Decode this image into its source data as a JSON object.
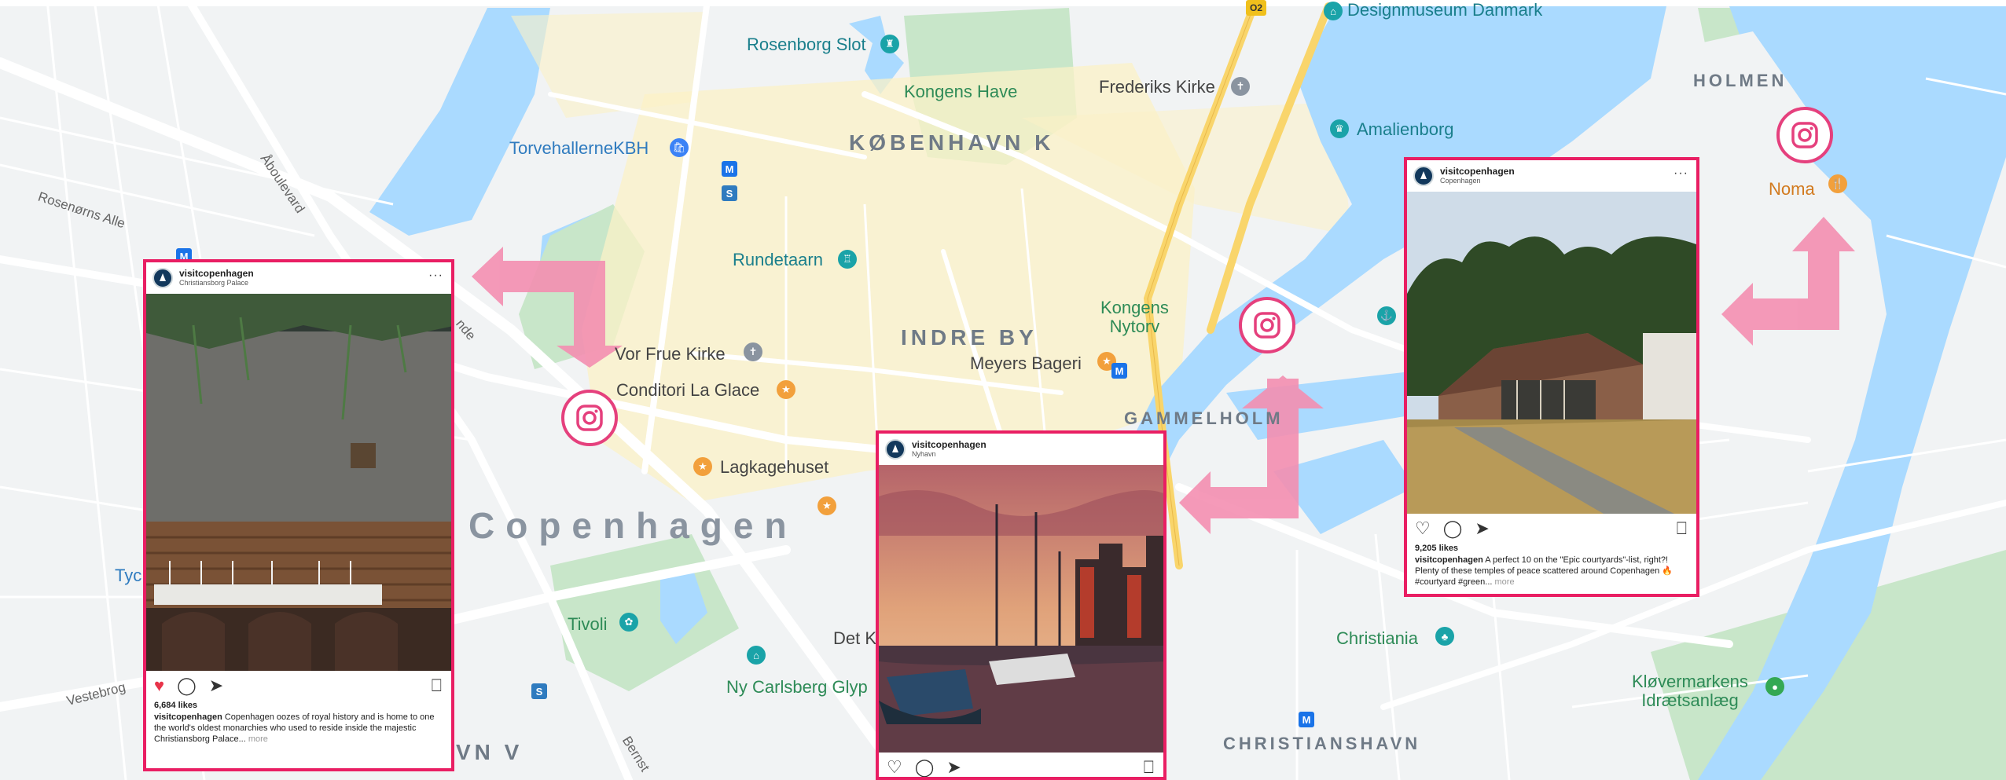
{
  "map": {
    "colors": {
      "land": "#f1f3f4",
      "water": "#aadaff",
      "park": "#c8e6c9",
      "road": "#ffffff",
      "highway": "#f9d56b",
      "block": "#fbf1c7",
      "pink": "#e91e63",
      "arrow": "#f48fb1"
    },
    "pois": [
      {
        "id": "rosenborg",
        "label": "Rosenborg Slot",
        "icon": "castle-icon",
        "color": "teal"
      },
      {
        "id": "kongens-have",
        "label": "Kongens Have",
        "icon": "",
        "color": "green"
      },
      {
        "id": "frederiks",
        "label": "Frederiks Kirke",
        "icon": "church-icon",
        "color": "dark"
      },
      {
        "id": "designmuseum",
        "label": "Designmuseum Danmark",
        "icon": "museum-icon",
        "color": "teal"
      },
      {
        "id": "amalienborg",
        "label": "Amalienborg",
        "icon": "palace-icon",
        "color": "teal"
      },
      {
        "id": "torvehallerne",
        "label": "TorvehallerneKBH",
        "icon": "shop-icon",
        "color": "blue"
      },
      {
        "id": "rundetaarn",
        "label": "Rundetaarn",
        "icon": "tower-icon",
        "color": "teal"
      },
      {
        "id": "vor-frue",
        "label": "Vor Frue Kirke",
        "icon": "church-icon",
        "color": "dark"
      },
      {
        "id": "la-glace",
        "label": "Conditori La Glace",
        "icon": "cafe-icon",
        "color": "dark"
      },
      {
        "id": "lagkagehuset",
        "label": "Lagkagehuset",
        "icon": "cafe-icon",
        "color": "dark"
      },
      {
        "id": "meyers",
        "label": "Meyers Bageri",
        "icon": "cafe-icon",
        "color": "dark"
      },
      {
        "id": "kongens-nytorv",
        "label": "Kongens\nNytorv",
        "icon": "",
        "color": "green"
      },
      {
        "id": "tivoli",
        "label": "Tivoli",
        "icon": "park-icon",
        "color": "green"
      },
      {
        "id": "det-k",
        "label": "Det K",
        "icon": "",
        "color": "dark"
      },
      {
        "id": "ny-carlsberg",
        "label": "Ny Carlsberg Glyp",
        "icon": "museum-icon",
        "color": "green"
      },
      {
        "id": "christiania",
        "label": "Christiania",
        "icon": "community-icon",
        "color": "green"
      },
      {
        "id": "noma",
        "label": "Noma",
        "icon": "restaurant-icon",
        "color": "orange"
      },
      {
        "id": "klovermarkens",
        "label": "Kløvermarkens\nIdrætsanlæg",
        "icon": "stadium-icon",
        "color": "green"
      },
      {
        "id": "tyc",
        "label": "Tyc",
        "icon": "",
        "color": "blue"
      }
    ],
    "districts": {
      "kobenhavn_k": "KØBENHAVN K",
      "indre_by": "INDRE BY",
      "gammelholm": "GAMMELHOLM",
      "holmen": "HOLMEN",
      "christianshavn": "CHRISTIANSHAVN",
      "vn_v": "VN V",
      "city": "Copenhagen"
    },
    "streets": {
      "rosenorns": "Rosenørns Alle",
      "aboulevard": "Åboulevard",
      "vestebro": "Vestebrog",
      "bern": "Bernst",
      "nde": "nde"
    },
    "markers": {
      "highway_shield": "O2",
      "metro": "M",
      "train": "S"
    }
  },
  "posts": [
    {
      "username": "visitcopenhagen",
      "location": "Christiansborg Palace",
      "likes": "6,684 likes",
      "liked": true,
      "caption": "Copenhagen oozes of royal history and is home to one the world's oldest monarchies who used to reside inside the majestic Christiansborg Palace...",
      "more": "more"
    },
    {
      "username": "visitcopenhagen",
      "location": "Nyhavn"
    },
    {
      "username": "visitcopenhagen",
      "location": "Copenhagen",
      "likes": "9,205 likes",
      "caption": "A perfect 10 on the \"Epic courtyards\"-list, right?! Plenty of these temples of peace scattered around Copenhagen 🔥 #courtyard #green...",
      "more": "more"
    }
  ]
}
